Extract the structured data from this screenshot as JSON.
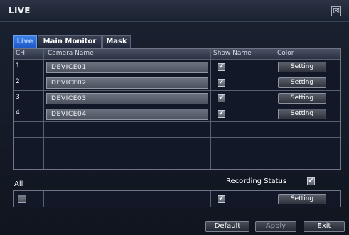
{
  "window": {
    "title": "LIVE",
    "close_glyph": "☒"
  },
  "tabs": [
    {
      "label": "Live",
      "active": true
    },
    {
      "label": "Main Monitor",
      "active": false
    },
    {
      "label": "Mask",
      "active": false
    }
  ],
  "table": {
    "headers": {
      "ch": "CH",
      "camera_name": "Camera Name",
      "show_name": "Show Name",
      "color": "Color"
    },
    "rows": [
      {
        "ch": "1",
        "name": "DEVICE01",
        "show_name": true,
        "color_button": "Setting"
      },
      {
        "ch": "2",
        "name": "DEVICE02",
        "show_name": true,
        "color_button": "Setting"
      },
      {
        "ch": "3",
        "name": "DEVICE03",
        "show_name": true,
        "color_button": "Setting"
      },
      {
        "ch": "4",
        "name": "DEVICE04",
        "show_name": true,
        "color_button": "Setting"
      }
    ]
  },
  "all": {
    "label": "All",
    "recording_status_label": "Recording Status",
    "recording_status_checked": true,
    "show_name_checked": true,
    "color_button": "Setting"
  },
  "footer": {
    "default": "Default",
    "apply": "Apply",
    "exit": "Exit"
  },
  "icons": {
    "check_glyph": "✔"
  }
}
